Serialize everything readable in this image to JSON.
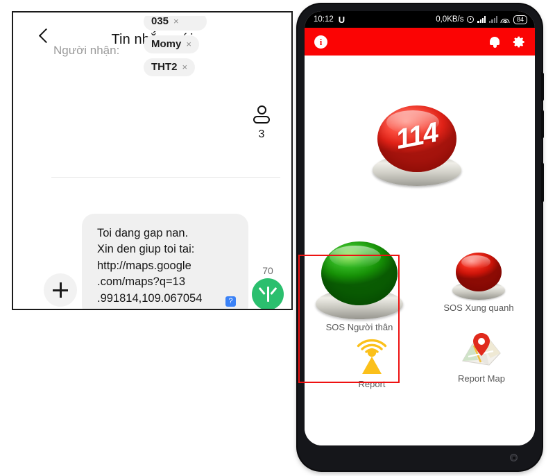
{
  "composer": {
    "title": "Tin nhắn mới",
    "back_icon": "back-chevron-icon",
    "recipients_label": "Người nhận:",
    "chips": [
      {
        "label": "035",
        "remove": "×"
      },
      {
        "label": "Momy",
        "remove": "×"
      },
      {
        "label": "THT2",
        "remove": "×"
      }
    ],
    "recipient_count": "3",
    "person_icon": "person-icon",
    "message": "Toi dang gap nan.\nXin den giup toi tai:\nhttp://maps.google\n.com/maps?q=13\n.991814,109.067054",
    "sim_badge": "?",
    "attach_label": "+",
    "char_count": "70",
    "send_icon": "arrow-up-icon"
  },
  "phone": {
    "statusbar": {
      "time": "10:12",
      "carrier_glyph": "U",
      "data_rate": "0,0KB/s",
      "alarm_icon": "alarm-icon",
      "signal_icon": "signal-bars-icon",
      "signal_icon_2": "signal-bars-dim-icon",
      "wifi_icon": "wifi-icon",
      "battery_level": "84"
    },
    "app_header": {
      "info_icon": "info-icon",
      "info_glyph": "i",
      "bell_icon": "bell-icon",
      "gear_icon": "gear-icon"
    },
    "main_button": {
      "label": "114",
      "name": "emergency-114-button",
      "color": "#f8483a"
    },
    "tiles": [
      {
        "label": "SOS Người thân",
        "icon": "green-dome-button-icon",
        "name": "sos-nguoi-than"
      },
      {
        "label": "SOS Xung quanh",
        "icon": "red-dome-button-icon",
        "name": "sos-xung-quanh"
      },
      {
        "label": "Report",
        "icon": "broadcast-tower-icon",
        "name": "report"
      },
      {
        "label": "Report Map",
        "icon": "map-pin-icon",
        "name": "report-map"
      }
    ]
  },
  "annotation": {
    "highlight_color": "#ee1111",
    "highlight_target": "SOS Người thân"
  }
}
